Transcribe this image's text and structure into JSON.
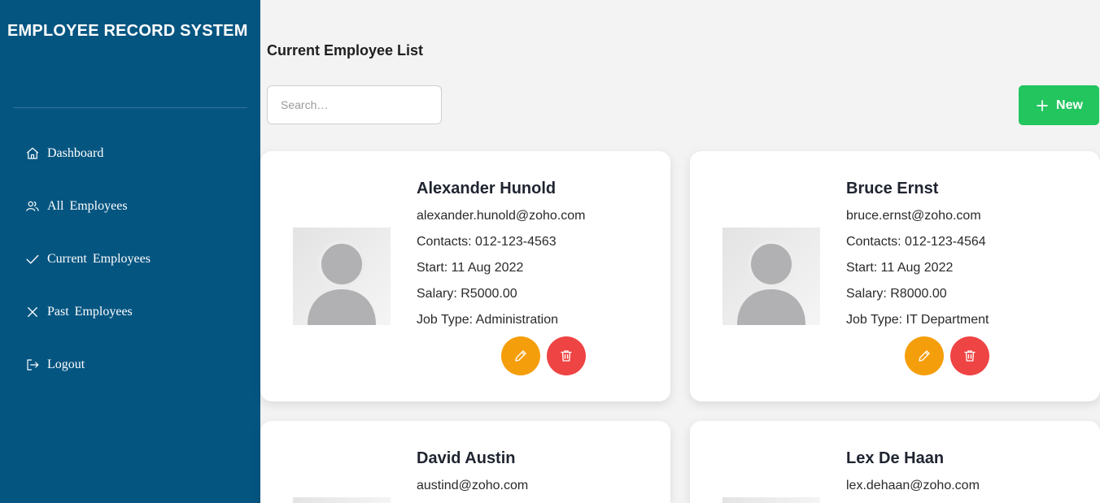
{
  "sidebar": {
    "title": "EMPLOYEE RECORD SYSTEM",
    "items": [
      {
        "label": "Dashboard",
        "icon": "home-icon"
      },
      {
        "label": "All  Employees",
        "icon": "users-icon"
      },
      {
        "label": "Current  Employees",
        "icon": "check-icon"
      },
      {
        "label": "Past  Employees",
        "icon": "x-icon"
      },
      {
        "label": "Logout",
        "icon": "logout-icon"
      }
    ]
  },
  "main": {
    "title": "Current Employee List",
    "search_placeholder": "Search…",
    "new_label": "New"
  },
  "employees": [
    {
      "name": "Alexander Hunold",
      "email": "alexander.hunold@zoho.com",
      "contacts": "Contacts: 012-123-4563",
      "start": "Start: 11 Aug 2022",
      "salary": "Salary: R5000.00",
      "job": "Job Type: Administration"
    },
    {
      "name": "Bruce Ernst",
      "email": "bruce.ernst@zoho.com",
      "contacts": "Contacts: 012-123-4564",
      "start": "Start: 11 Aug 2022",
      "salary": "Salary: R8000.00",
      "job": "Job Type: IT Department"
    },
    {
      "name": "David Austin",
      "email": "austind@zoho.com"
    },
    {
      "name": "Lex De Haan",
      "email": "lex.dehaan@zoho.com"
    }
  ],
  "colors": {
    "sidebar_bg": "#055581",
    "page_bg": "#f3f3f3",
    "new_button": "#22c55e",
    "edit_button": "#f59e0b",
    "delete_button": "#ef4444"
  }
}
